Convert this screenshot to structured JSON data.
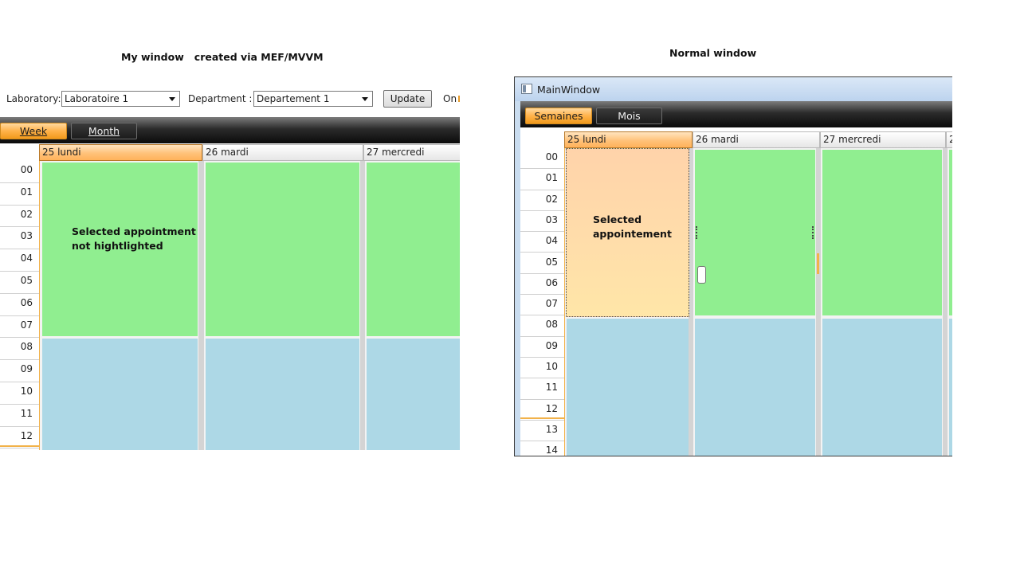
{
  "left_panel": {
    "heading": "My window   created via MEF/MVVM",
    "toolbar": {
      "laboratory_label": "Laboratory:",
      "laboratory_value": "Laboratoire 1",
      "department_label": "Department :",
      "department_value": "Departement 1",
      "update_label": "Update",
      "on_label": "On"
    },
    "tabs": [
      {
        "label": "Week",
        "active": true
      },
      {
        "label": "Month",
        "active": false
      }
    ],
    "days": [
      "25 lundi",
      "26 mardi",
      "27 mercredi"
    ],
    "hours": [
      "00",
      "01",
      "02",
      "03",
      "04",
      "05",
      "06",
      "07",
      "08",
      "09",
      "10",
      "11",
      "12"
    ],
    "annotation": "Selected appointment\nnot hightlighted"
  },
  "right_panel": {
    "heading": "Normal window",
    "window_title": "MainWindow",
    "tabs": [
      {
        "label": "Semaines",
        "active": true
      },
      {
        "label": "Mois",
        "active": false
      }
    ],
    "days": [
      "25 lundi",
      "26 mardi",
      "27 mercredi",
      "2"
    ],
    "hours": [
      "00",
      "01",
      "02",
      "03",
      "04",
      "05",
      "06",
      "07",
      "08",
      "09",
      "10",
      "11",
      "12",
      "13",
      "14"
    ],
    "annotation": "Selected\nappointement"
  },
  "colors": {
    "appointment_green": "#90ee90",
    "appointment_blue": "#add8e6",
    "selected_orange": "#ffb24a"
  }
}
